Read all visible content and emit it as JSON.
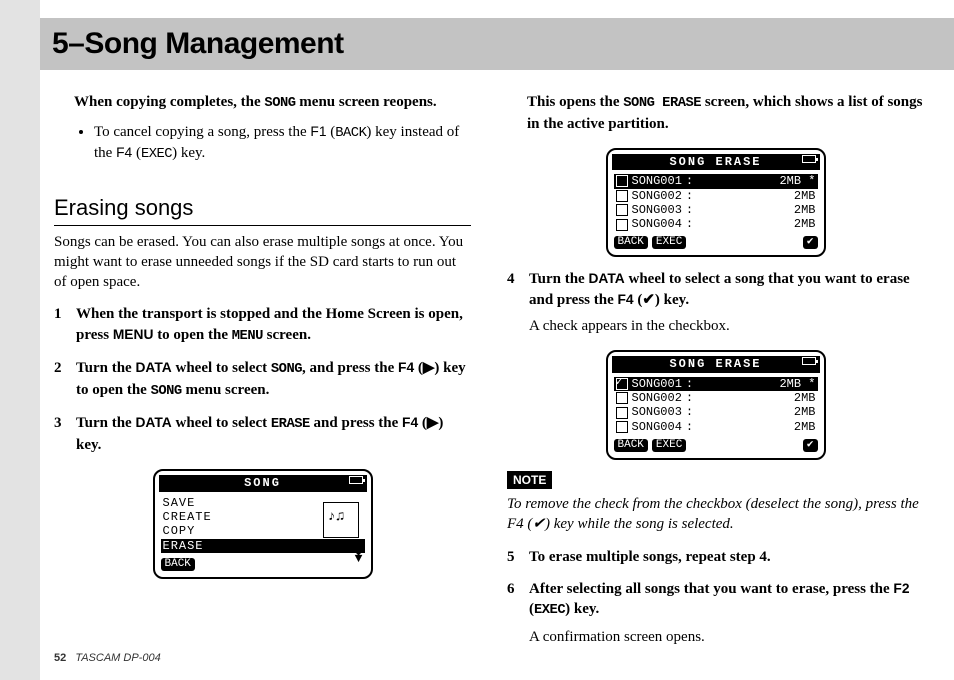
{
  "page": {
    "chapter_title": "5–Song Management",
    "footer_page": "52",
    "footer_model": "TASCAM  DP-004"
  },
  "left": {
    "p1_a": "When copying completes, the ",
    "p1_song": "SONG",
    "p1_b": " menu screen reopens.",
    "bullet_a": "To cancel copying a song, press the ",
    "bullet_f1": "F1",
    "bullet_paren_open": " (",
    "bullet_back": "BACK",
    "bullet_paren_close": ")",
    "bullet_b": " key instead of the ",
    "bullet_f4": "F4",
    "bullet_paren_open2": " (",
    "bullet_exec": "EXEC",
    "bullet_paren_close2": ")",
    "bullet_c": " key.",
    "subheading": "Erasing songs",
    "intro": "Songs can be erased. You can also erase multiple songs at once. You might want to erase unneeded songs if the SD card starts to run out of open space.",
    "s1_a": "When the transport is stopped and the Home Screen is open, press ",
    "s1_menu_sans": "MENU",
    "s1_b": " to open the ",
    "s1_menu_mono": "MENU",
    "s1_c": " screen.",
    "s2_a": " Turn the ",
    "s2_data": "DATA",
    "s2_b": " wheel to select ",
    "s2_song": "SONG",
    "s2_c": ", and press the ",
    "s2_f4": "F4",
    "s2_d": " (▶) key to open the ",
    "s2_song2": "SONG",
    "s2_e": " menu screen.",
    "s3_a": "Turn the ",
    "s3_data": "DATA",
    "s3_b": " wheel to select ",
    "s3_erase": "ERASE",
    "s3_c": " and press the ",
    "s3_f4": "F4",
    "s3_d": " (▶) key."
  },
  "right": {
    "top_a": "This opens the ",
    "top_serase": "SONG ERASE",
    "top_b": " screen, which shows a list of songs in the active partition.",
    "s4_a": "Turn the ",
    "s4_data": "DATA",
    "s4_b": " wheel to select a song that you want to erase and press the ",
    "s4_f4": "F4",
    "s4_c": " (✔) key.",
    "s4_sub": "A check appears in the checkbox.",
    "note_label": "NOTE",
    "note_body": "To remove the check from the checkbox (deselect the song), press the F4 (✔) key while the song is selected.",
    "s5": "To erase multiple songs, repeat step 4.",
    "s6_a": "After selecting all songs that you want to erase, press the ",
    "s6_f2": "F2",
    "s6_open": " (",
    "s6_exec": "EXEC",
    "s6_close": ")",
    "s6_b": " key.",
    "s6_sub": "A confirmation screen opens."
  },
  "lcd_menu": {
    "title": "SONG",
    "items": [
      "SAVE",
      "CREATE",
      "COPY",
      "ERASE"
    ],
    "selected_index": 3,
    "back": "BACK"
  },
  "lcd_erase_1": {
    "title": "SONG ERASE",
    "rows": [
      {
        "checked": false,
        "name": "SONG001",
        "size": "2MB",
        "star": true,
        "selected": true
      },
      {
        "checked": false,
        "name": "SONG002",
        "size": "2MB",
        "star": false,
        "selected": false
      },
      {
        "checked": false,
        "name": "SONG003",
        "size": "2MB",
        "star": false,
        "selected": false
      },
      {
        "checked": false,
        "name": "SONG004",
        "size": "2MB",
        "star": false,
        "selected": false
      }
    ],
    "back": "BACK",
    "exec": "EXEC",
    "check": "✔"
  },
  "lcd_erase_2": {
    "title": "SONG ERASE",
    "rows": [
      {
        "checked": true,
        "name": "SONG001",
        "size": "2MB",
        "star": true,
        "selected": true
      },
      {
        "checked": false,
        "name": "SONG002",
        "size": "2MB",
        "star": false,
        "selected": false
      },
      {
        "checked": false,
        "name": "SONG003",
        "size": "2MB",
        "star": false,
        "selected": false
      },
      {
        "checked": false,
        "name": "SONG004",
        "size": "2MB",
        "star": false,
        "selected": false
      }
    ],
    "back": "BACK",
    "exec": "EXEC",
    "check": "✔"
  }
}
